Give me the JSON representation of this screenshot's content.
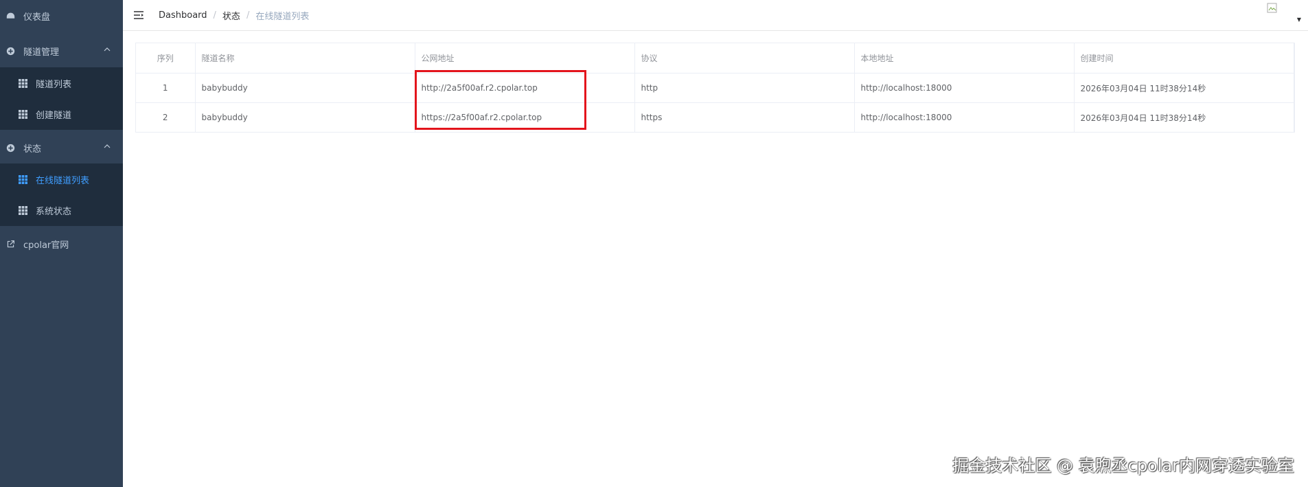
{
  "sidebar": {
    "dashboard": "仪表盘",
    "tunnel_mgmt": "隧道管理",
    "tunnel_list": "隧道列表",
    "create_tunnel": "创建隧道",
    "status": "状态",
    "online_tunnels": "在线隧道列表",
    "system_status": "系统状态",
    "website": "cpolar官网"
  },
  "breadcrumb": {
    "items": [
      "Dashboard",
      "状态",
      "在线隧道列表"
    ]
  },
  "table": {
    "headers": [
      "序列",
      "隧道名称",
      "公网地址",
      "协议",
      "本地地址",
      "创建时间"
    ],
    "rows": [
      [
        "1",
        "babybuddy",
        "http://2a5f00af.r2.cpolar.top",
        "http",
        "http://localhost:18000",
        "2026年03月04日 11时38分14秒"
      ],
      [
        "2",
        "babybuddy",
        "https://2a5f00af.r2.cpolar.top",
        "https",
        "http://localhost:18000",
        "2026年03月04日 11时38分14秒"
      ]
    ]
  },
  "watermark": "掘金技术社区 @ 袁煦丞cpolar内网穿透实验室",
  "colors": {
    "sidebar_bg": "#304156",
    "submenu_bg": "#1f2d3d",
    "active": "#409eff",
    "highlight": "#e3141c"
  },
  "icons": {
    "dashboard": "dashboard-icon",
    "circle_plus": "circle-plus-icon",
    "grid": "grid-icon",
    "external": "external-link-icon",
    "hamburger": "hamburger-icon"
  }
}
